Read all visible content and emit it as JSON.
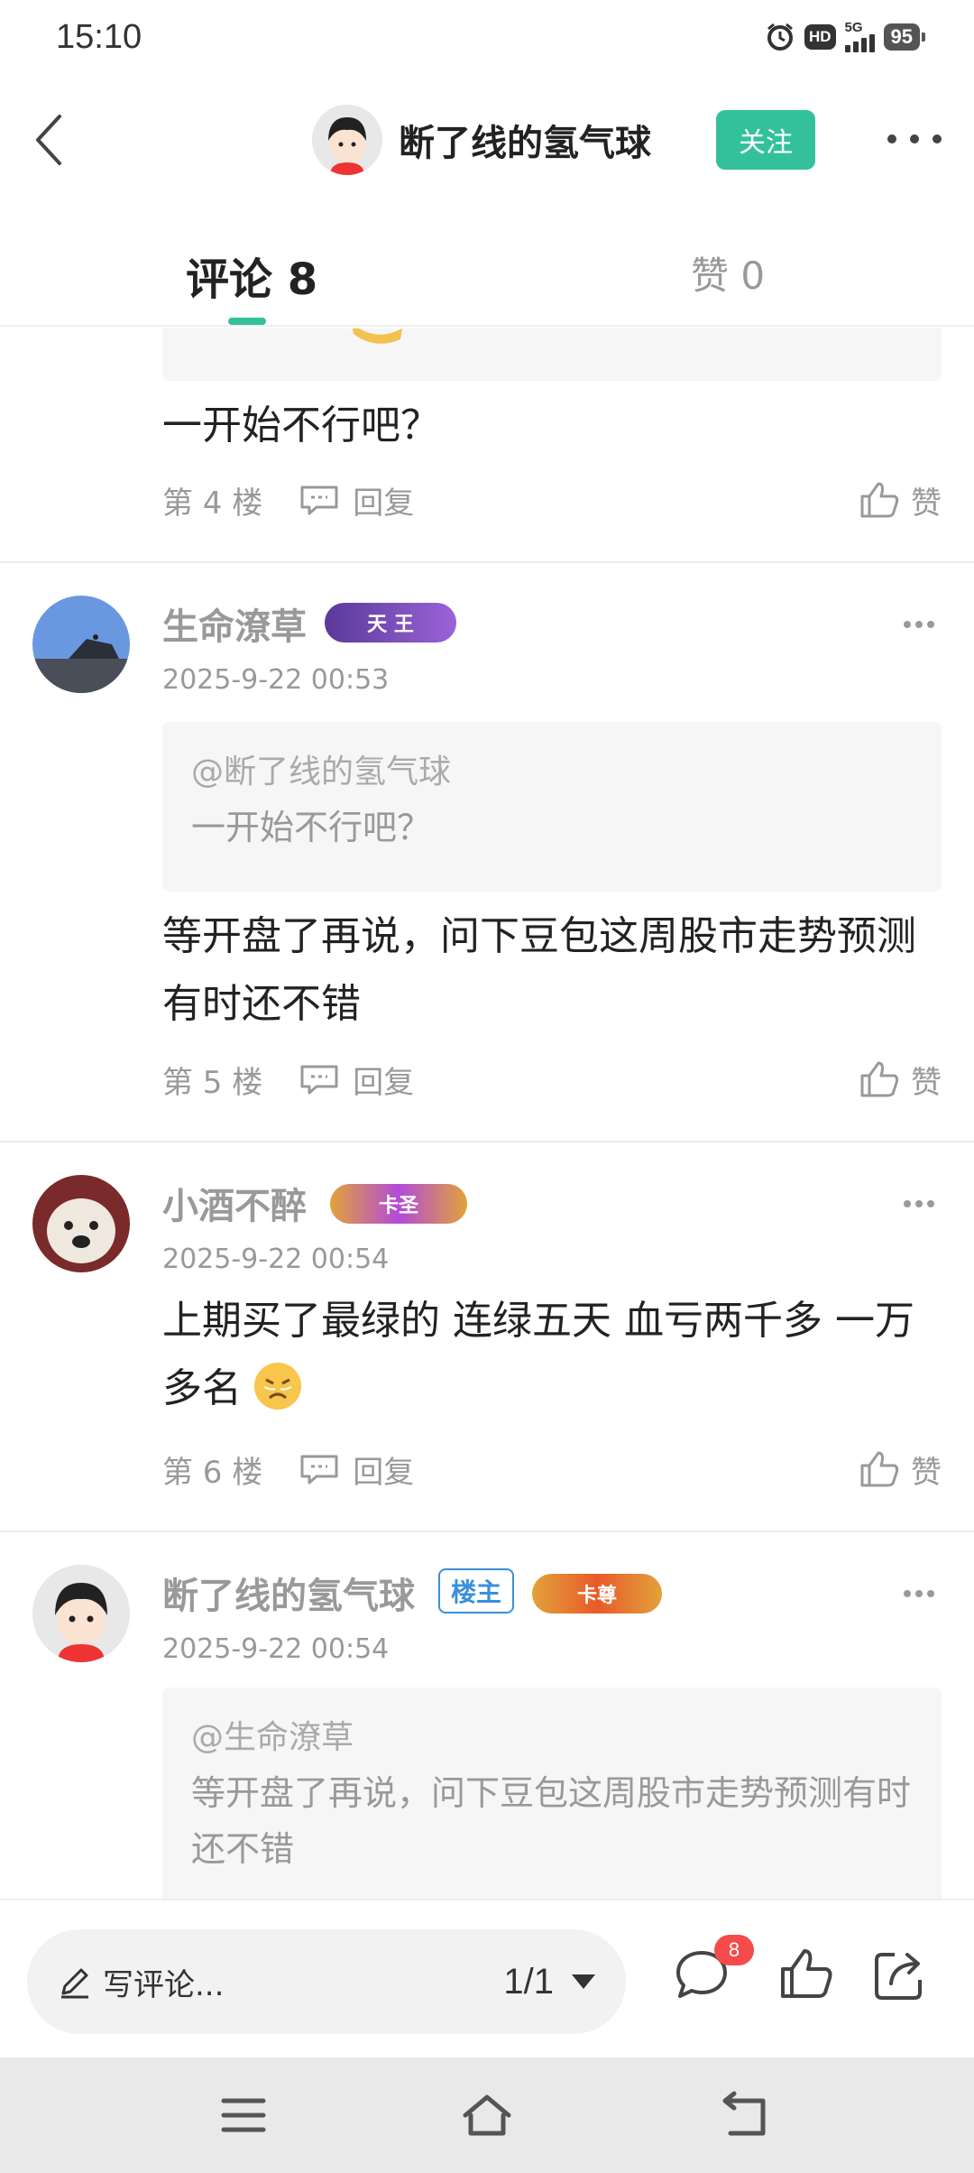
{
  "status_bar": {
    "time": "15:10",
    "hd": "HD",
    "network": "5G",
    "battery": "95"
  },
  "header": {
    "author_name": "断了线的氢气球",
    "follow_label": "关注"
  },
  "tabs": {
    "comments": "评论 8",
    "likes": "赞 0"
  },
  "comments": [
    {
      "text": "一开始不行吧？",
      "floor": "第 4 楼",
      "reply_label": "回复",
      "like_label": "赞"
    },
    {
      "name": "生命潦草",
      "badge": "天 王",
      "date": "2025-9-22 00:53",
      "quote_at": "@断了线的氢气球",
      "quote_text": "一开始不行吧？",
      "text": "等开盘了再说，问下豆包这周股市走势预测有时还不错",
      "floor": "第 5 楼",
      "reply_label": "回复",
      "like_label": "赞"
    },
    {
      "name": "小酒不醉",
      "badge": "卡圣",
      "date": "2025-9-22 00:54",
      "text": "上期买了最绿的 连绿五天 血亏两千多 一万多名",
      "floor": "第 6 楼",
      "reply_label": "回复",
      "like_label": "赞"
    },
    {
      "name": "断了线的氢气球",
      "owner_tag": "楼主",
      "badge": "卡尊",
      "date": "2025-9-22 00:54",
      "quote_at": "@生命潦草",
      "quote_text": "等开盘了再说，问下豆包这周股市走势预测有时还不错"
    }
  ],
  "bottom_bar": {
    "placeholder": "写评论...",
    "pager": "1/1",
    "comment_count": "8"
  },
  "colors": {
    "accent": "#33c19c",
    "badge_red": "#f54b4b"
  }
}
